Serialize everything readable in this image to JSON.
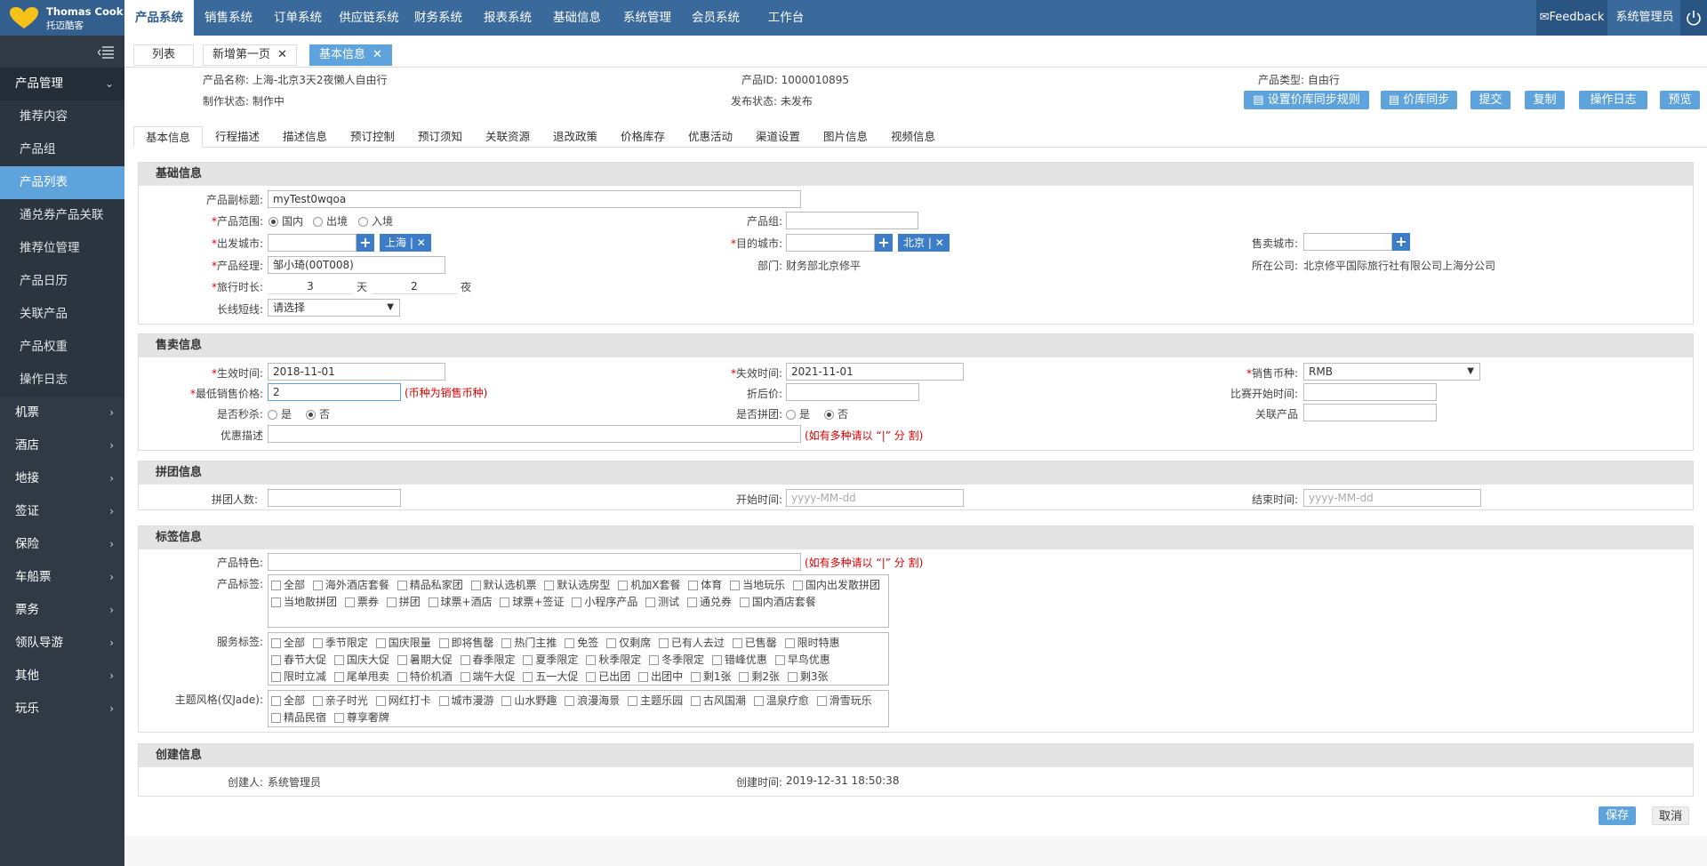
{
  "header": {
    "logo_line1": "Thomas Cook",
    "logo_line2": "托迈酷客",
    "nav": [
      {
        "label": "产品系统",
        "active": true
      },
      {
        "label": "销售系统"
      },
      {
        "label": "订单系统"
      },
      {
        "label": "供应链系统"
      },
      {
        "label": "财务系统"
      },
      {
        "label": "报表系统"
      },
      {
        "label": "基础信息"
      },
      {
        "label": "系统管理"
      },
      {
        "label": "会员系统"
      },
      {
        "label": "工作台"
      }
    ],
    "feedback": "Feedback",
    "user": "系统管理员"
  },
  "sidebar": {
    "group": "产品管理",
    "sub": [
      "推荐内容",
      "产品组",
      "产品列表",
      "通兑券产品关联",
      "推荐位管理",
      "产品日历",
      "关联产品",
      "产品权重",
      "操作日志"
    ],
    "active_sub": "产品列表",
    "collapsed": [
      "机票",
      "酒店",
      "地接",
      "签证",
      "保险",
      "车船票",
      "票务",
      "领队导游",
      "其他",
      "玩乐"
    ]
  },
  "page_tabs": [
    {
      "label": "列表"
    },
    {
      "label": "新增第一页",
      "close": "✕"
    },
    {
      "label": "基本信息",
      "close": "✕",
      "active": true
    }
  ],
  "product_info": {
    "name_label": "产品名称:",
    "name": "上海-北京3天2夜懒人自由行",
    "id_label": "产品ID:",
    "id": "1000010895",
    "type_label": "产品类型:",
    "type": "自由行",
    "make_label": "制作状态:",
    "make": "制作中",
    "publish_label": "发布状态:",
    "publish": "未发布"
  },
  "actions": [
    "设置价库同步规则",
    "价库同步",
    "提交",
    "复制",
    "操作日志",
    "预览"
  ],
  "sub_tabs": [
    "基本信息",
    "行程描述",
    "描述信息",
    "预订控制",
    "预订须知",
    "关联资源",
    "退改政策",
    "价格库存",
    "优惠活动",
    "渠道设置",
    "图片信息",
    "视频信息"
  ],
  "basic": {
    "title": "基础信息",
    "subtitle_label": "产品副标题:",
    "subtitle_value": "myTest0wqoa",
    "scope_label": "产品范围:",
    "scope_options": [
      "国内",
      "出境",
      "入境"
    ],
    "group_label": "产品组:",
    "depart_label": "出发城市:",
    "depart_chip": "上海",
    "dest_label": "目的城市:",
    "dest_chip": "北京",
    "sale_city_label": "售卖城市:",
    "manager_label": "产品经理:",
    "manager_value": "邹小琦(00T008)",
    "dept_label": "部门:",
    "dept_value": "财务部北京修平",
    "company_label": "所在公司:",
    "company_value": "北京修平国际旅行社有限公司上海分公司",
    "duration_label": "旅行时长:",
    "days": "3",
    "days_unit": "天",
    "nights": "2",
    "nights_unit": "夜",
    "line_label": "长线短线:",
    "line_value": "请选择"
  },
  "sale": {
    "title": "售卖信息",
    "start_label": "生效时间:",
    "start_value": "2018-11-01",
    "end_label": "失效时间:",
    "end_value": "2021-11-01",
    "currency_label": "销售币种:",
    "currency_value": "RMB",
    "minprice_label": "最低销售价格:",
    "minprice_value": "2",
    "minprice_hint": "(币种为销售币种)",
    "discount_label": "折后价:",
    "compare_label": "比赛开始时间:",
    "seckill_label": "是否秒杀:",
    "group_buy_label": "是否拼团:",
    "yes": "是",
    "no": "否",
    "related_label": "关联产品",
    "promo_label": "优惠描述",
    "promo_hint": "(如有多种请以 “|” 分 割)"
  },
  "groupbuy": {
    "title": "拼团信息",
    "count_label": "拼团人数:",
    "start_label": "开始时间:",
    "start_ph": "yyyy-MM-dd",
    "end_label": "结束时间:",
    "end_ph": "yyyy-MM-dd"
  },
  "tags": {
    "title": "标签信息",
    "feature_label": "产品特色:",
    "feature_hint": "(如有多种请以 “|” 分 割)",
    "product_tags_label": "产品标签:",
    "product_tags": [
      "全部",
      "海外酒店套餐",
      "精品私家团",
      "默认选机票",
      "默认选房型",
      "机加X套餐",
      "体育",
      "当地玩乐",
      "国内出发散拼团",
      "当地散拼团",
      "票券",
      "拼团",
      "球票+酒店",
      "球票+签证",
      "小程序产品",
      "测试",
      "通兑券",
      "国内酒店套餐"
    ],
    "service_tags_label": "服务标签:",
    "service_tags": [
      "全部",
      "季节限定",
      "国庆限量",
      "即将售罄",
      "热门主推",
      "免签",
      "仅剩席",
      "已有人去过",
      "已售罄",
      "限时特惠",
      "春节大促",
      "国庆大促",
      "暑期大促",
      "春季限定",
      "夏季限定",
      "秋季限定",
      "冬季限定",
      "错峰优惠",
      "早鸟优惠",
      "限时立减",
      "尾单甩卖",
      "特价机酒",
      "端午大促",
      "五一大促",
      "已出团",
      "出团中",
      "剩1张",
      "剩2张",
      "剩3张"
    ],
    "theme_label": "主题风格(仅Jade):",
    "theme_tags": [
      "全部",
      "亲子时光",
      "网红打卡",
      "城市漫游",
      "山水野趣",
      "浪漫海景",
      "主题乐园",
      "古风国潮",
      "温泉疗愈",
      "滑雪玩乐",
      "精品民宿",
      "尊享奢牌"
    ]
  },
  "create": {
    "title": "创建信息",
    "creator_label": "创建人:",
    "creator": "系统管理员",
    "time_label": "创建时间:",
    "time": "2019-12-31 18:50:38"
  },
  "footer": {
    "save": "保存",
    "cancel": "取消"
  }
}
